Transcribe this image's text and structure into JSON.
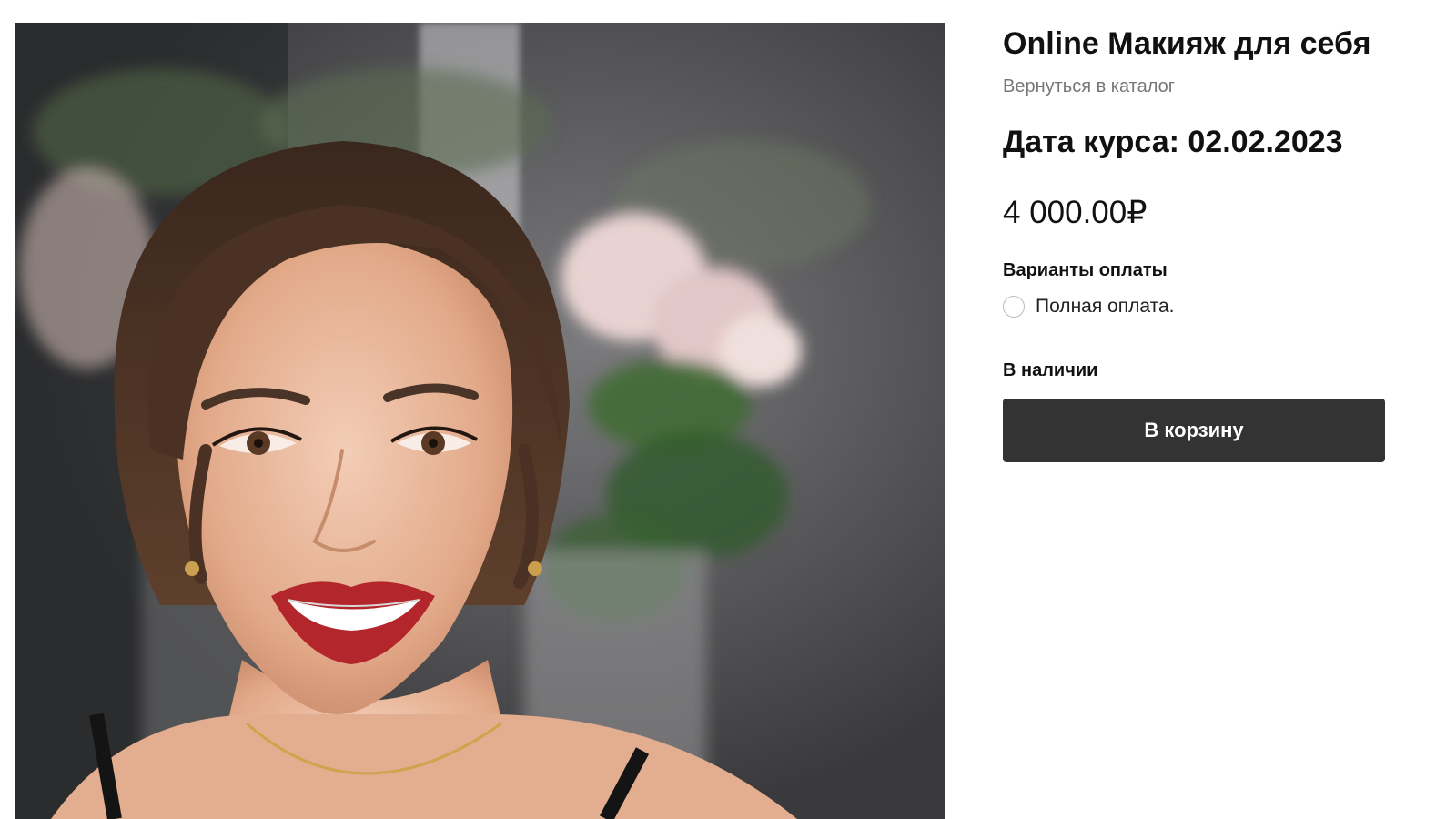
{
  "product": {
    "title": "Online Макияж для себя",
    "back_link": "Вернуться в каталог",
    "date_label": "Дата курса: ",
    "date_value": "02.02.2023",
    "price": "4 000.00₽",
    "payment": {
      "title": "Варианты оплаты",
      "options": [
        {
          "label": "Полная оплата.",
          "selected": false
        }
      ]
    },
    "availability": "В наличии",
    "cart_button": "В корзину",
    "image_alt": "woman-portrait-photo"
  },
  "colors": {
    "button_bg": "#333333",
    "button_text": "#ffffff",
    "muted_text": "#777777",
    "lipstick": "#b3262b"
  }
}
